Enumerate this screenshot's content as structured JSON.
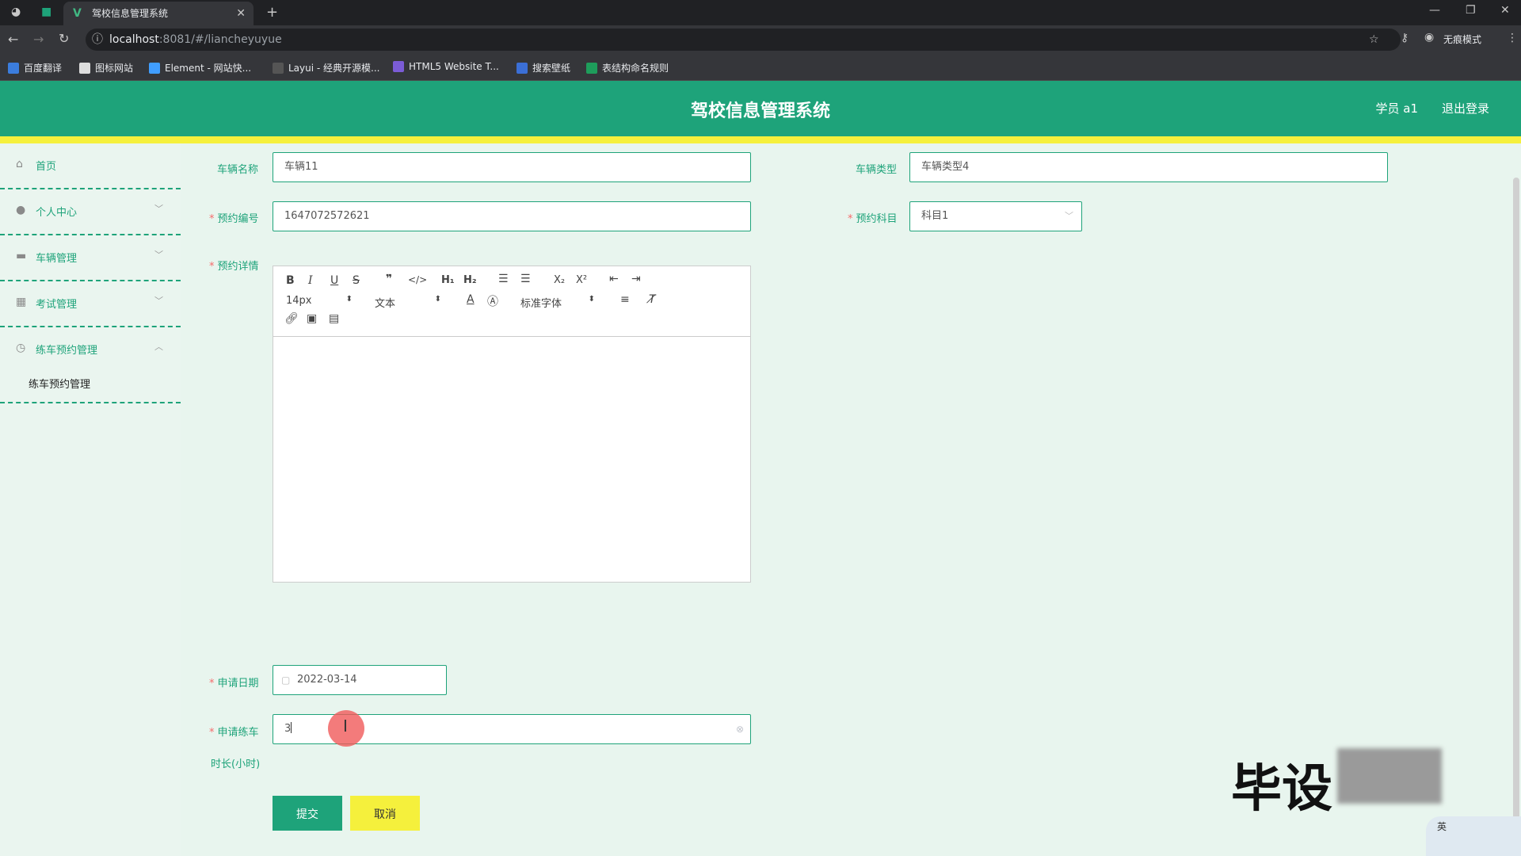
{
  "browser": {
    "tab_title": "驾校信息管理系统",
    "url_host": "localhost",
    "url_rest": ":8081/#/liancheyuyue",
    "profile_label": "无痕模式",
    "bookmarks": [
      "百度翻译",
      "图标网站",
      "Element - 网站快...",
      "Layui - 经典开源模...",
      "HTML5 Website T...",
      "搜索壁纸",
      "表结构命名规则"
    ]
  },
  "header": {
    "title": "驾校信息管理系统",
    "user": "学员 a1",
    "logout": "退出登录"
  },
  "sidebar": {
    "items": [
      {
        "label": "首页",
        "icon": "home-icon"
      },
      {
        "label": "个人中心",
        "icon": "user-icon"
      },
      {
        "label": "车辆管理",
        "icon": "briefcase-icon"
      },
      {
        "label": "考试管理",
        "icon": "grid-icon"
      },
      {
        "label": "练车预约管理",
        "icon": "clock-icon"
      }
    ],
    "sub_item": "练车预约管理"
  },
  "form": {
    "vehicle_name_label": "车辆名称",
    "vehicle_name_value": "车辆11",
    "vehicle_type_label": "车辆类型",
    "vehicle_type_value": "车辆类型4",
    "booking_no_label": "预约编号",
    "booking_no_value": "1647072572621",
    "subject_label": "预约科目",
    "subject_value": "科目1",
    "detail_label": "预约详情",
    "apply_date_label": "申请日期",
    "apply_date_value": "2022-03-14",
    "duration_label_1": "申请练车",
    "duration_label_2": "时长(小时)",
    "duration_value": "3",
    "submit": "提交",
    "cancel": "取消"
  },
  "editor_toolbar": {
    "size": "14px",
    "header": "文本",
    "font": "标准字体"
  },
  "overlay": {
    "watermark": "毕设",
    "ime": "英"
  },
  "colors": {
    "accent": "#1ea37a",
    "yellow": "#f5f03c",
    "required": "#f56c6c"
  }
}
